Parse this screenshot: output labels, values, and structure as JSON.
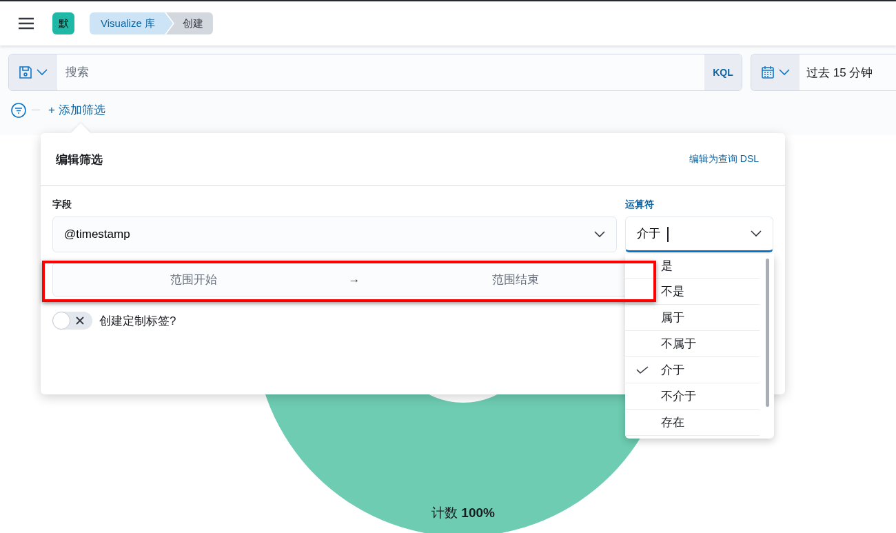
{
  "header": {
    "space_badge": "默",
    "breadcrumbs": [
      {
        "label": "Visualize 库",
        "selected": false
      },
      {
        "label": "创建",
        "selected": true
      }
    ]
  },
  "query_bar": {
    "search": {
      "placeholder": "搜索"
    },
    "language": "KQL",
    "date": {
      "value": "过去 15 分钟"
    }
  },
  "filter_bar": {
    "add_filter": "+ 添加筛选"
  },
  "chart": {
    "slice_label": "计数 **100%**"
  },
  "edit_filter": {
    "title": "编辑筛选",
    "dsl_link": "编辑为查询 DSL",
    "field": {
      "label": "字段",
      "value": "@timestamp"
    },
    "operator": {
      "label": "运算符",
      "value": "介于",
      "focused": true
    },
    "range": {
      "start_placeholder": "范围开始",
      "arrow": "→",
      "end_placeholder": "范围结束"
    },
    "custom_label": {
      "label": "创建定制标签?",
      "on": false
    },
    "operator_options": [
      {
        "label": "是",
        "selected": false
      },
      {
        "label": "不是",
        "selected": false
      },
      {
        "label": "属于",
        "selected": false
      },
      {
        "label": "不属于",
        "selected": false
      },
      {
        "label": "介于",
        "selected": true
      },
      {
        "label": "不介于",
        "selected": false
      },
      {
        "label": "存在",
        "selected": false
      }
    ]
  }
}
